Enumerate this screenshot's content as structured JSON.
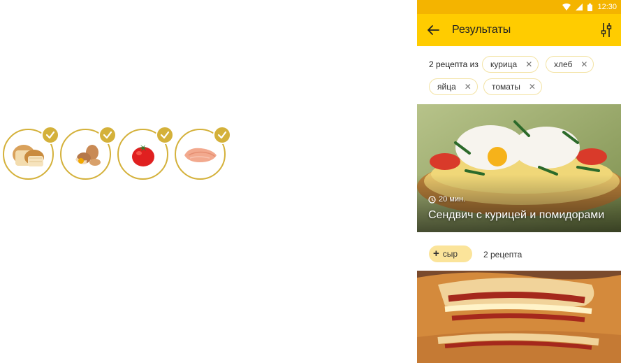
{
  "ingredients": [
    {
      "icon": "bread-icon",
      "checked": true
    },
    {
      "icon": "eggs-icon",
      "checked": true
    },
    {
      "icon": "tomato-icon",
      "checked": true
    },
    {
      "icon": "chicken-icon",
      "checked": true
    }
  ],
  "statusbar": {
    "time": "12:30"
  },
  "appbar": {
    "title": "Результаты"
  },
  "filters": {
    "count_label": "2 рецепта из",
    "chips": [
      {
        "label": "курица"
      },
      {
        "label": "хлеб"
      },
      {
        "label": "яйца"
      },
      {
        "label": "томаты"
      }
    ]
  },
  "recipe": {
    "time": "20 мин.",
    "title": "Сендвич с курицей и помидорами"
  },
  "suggestion": {
    "chip_label": "сыр",
    "count": "2 рецепта"
  },
  "colors": {
    "accent": "#ffcc00",
    "statusbar": "#f4b400",
    "check": "#d4b13a",
    "chip_border": "#f3e3a4"
  }
}
